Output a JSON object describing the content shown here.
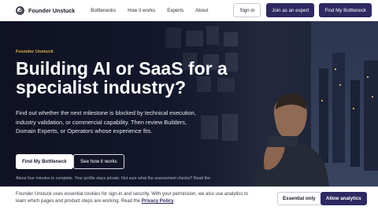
{
  "brand": {
    "name": "Founder Unstuck",
    "logo_icon": "swirl-logo-icon"
  },
  "nav": {
    "links": [
      "Bottlenecks",
      "How it works",
      "Experts",
      "About"
    ],
    "sign_in": "Sign in",
    "join_expert": "Join as an expert",
    "find_bottleneck": "Find My Bottleneck"
  },
  "hero": {
    "eyebrow": "Founder Unstuck",
    "title": "Building AI or SaaS for a specialist industry?",
    "description": "Find out whether the next milestone is blocked by technical execution, industry validation, or commercial capability. Then review Builders, Domain Experts, or Operators whose experience fits.",
    "cta_primary": "Find My Bottleneck",
    "cta_secondary": "See how it works",
    "note": "About four minutes to complete. Your profile stays private. Not sure what the assessment checks? Read the"
  },
  "cookie": {
    "text": "Founder Unstuck uses essential cookies for sign-in and security. With your permission, we also use analytics to learn which pages and product steps are working. Read the",
    "link": "Privacy Policy",
    "text_end": ".",
    "essential_only": "Essential only",
    "allow_analytics": "Allow analytics"
  },
  "colors": {
    "brand_primary": "#2e2960",
    "accent": "#d8b24a",
    "hero_bg": "#171a2d"
  }
}
